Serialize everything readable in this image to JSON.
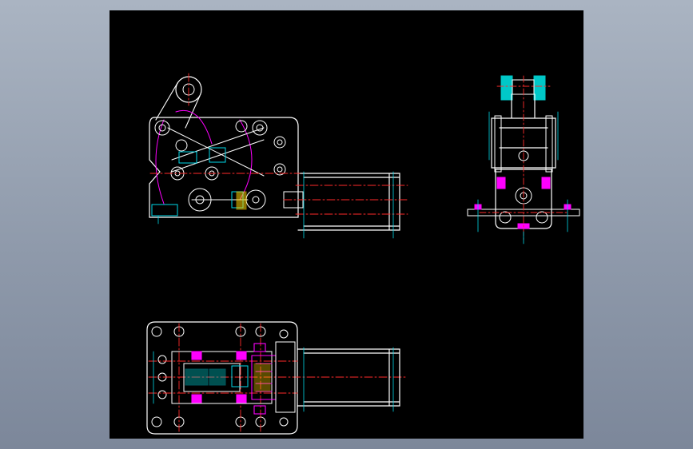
{
  "viewer": {
    "background_top": "#aab4c2",
    "background_bottom": "#7c879a",
    "sheet_color": "#000000"
  },
  "palette": {
    "outline": "#ffffff",
    "centerline": "#ff2a2a",
    "dimension": "#00d8e8",
    "section": "#ff00ff",
    "hatch": "#00c8c8",
    "accent": "#ffd400",
    "fastener": "#ff00ff"
  },
  "views": [
    {
      "id": "front-view",
      "label": ""
    },
    {
      "id": "side-view",
      "label": ""
    },
    {
      "id": "top-view",
      "label": ""
    }
  ]
}
